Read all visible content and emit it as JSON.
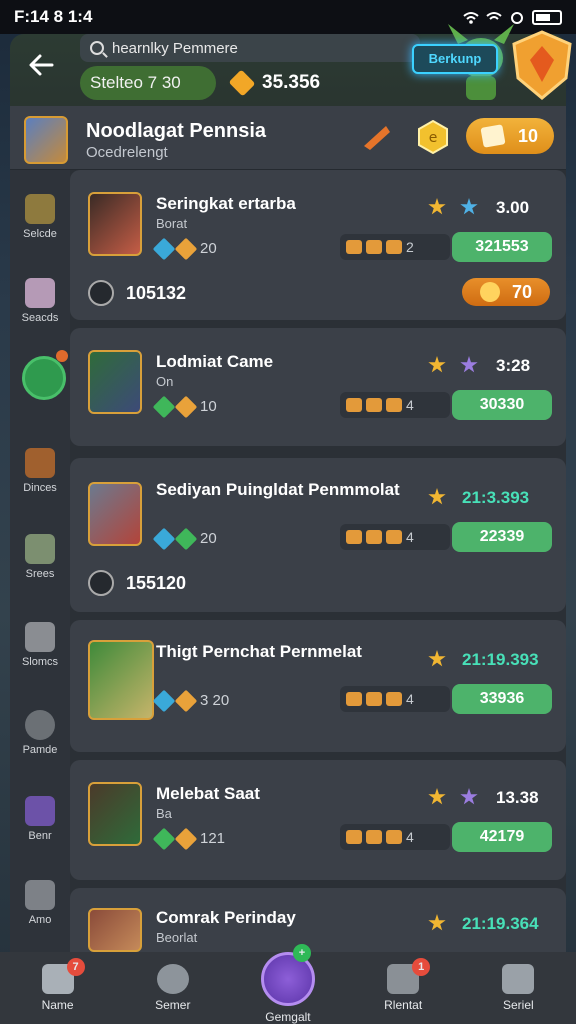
{
  "status_bar": {
    "time": "F:14 8 1:4"
  },
  "top": {
    "search_text": "hearnlky Pemmere",
    "status_label": "Stelteo 7 30",
    "coins": "35.356",
    "event_label": "Berkunp"
  },
  "header": {
    "title": "Noodlagat Pennsia",
    "subtitle": "Ocedrelengt",
    "pill_value": "10"
  },
  "sidebar": {
    "items": [
      {
        "label": "Selcde"
      },
      {
        "label": "Seacds"
      },
      {
        "label": "Dinces"
      },
      {
        "label": "Srees"
      },
      {
        "label": "Slomcs"
      },
      {
        "label": "Pamde"
      },
      {
        "label": "Benr"
      },
      {
        "label": "Amo"
      }
    ]
  },
  "cards": [
    {
      "name": "Seringkat ertarba",
      "sub": "Borat",
      "tag_value": "20",
      "rating": "3.00",
      "items_count": "2",
      "price": "321553",
      "extra_value": "105132",
      "extra_pill": "70"
    },
    {
      "name": "Lodmiat Came",
      "sub": "On",
      "tag_value": "10",
      "rating": "3:28",
      "items_count": "4",
      "price": "30330"
    },
    {
      "name": "Sediyan Puingldat Penmmolat",
      "sub": "",
      "tag_value": "20",
      "rating": "21:3.393",
      "items_count": "4",
      "price": "22339",
      "extra_value": "155120"
    },
    {
      "name": "Thigt Pernchat Pernmelat",
      "sub": "",
      "tag_value": "3 20",
      "rating": "21:19.393",
      "items_count": "4",
      "price": "33936"
    },
    {
      "name": "Melebat Saat",
      "sub": "Ba",
      "tag_value": "121",
      "rating": "13.38",
      "items_count": "4",
      "price": "42179"
    },
    {
      "name": "Comrak Perinday",
      "sub": "Beorlat",
      "rating": "21:19.364"
    }
  ],
  "bottom_nav": [
    {
      "label": "Name",
      "badge": "7"
    },
    {
      "label": "Semer",
      "badge": ""
    },
    {
      "label": "Gemgalt",
      "badge": ""
    },
    {
      "label": "Rlentat",
      "badge": "1"
    },
    {
      "label": "Seriel",
      "badge": ""
    }
  ]
}
